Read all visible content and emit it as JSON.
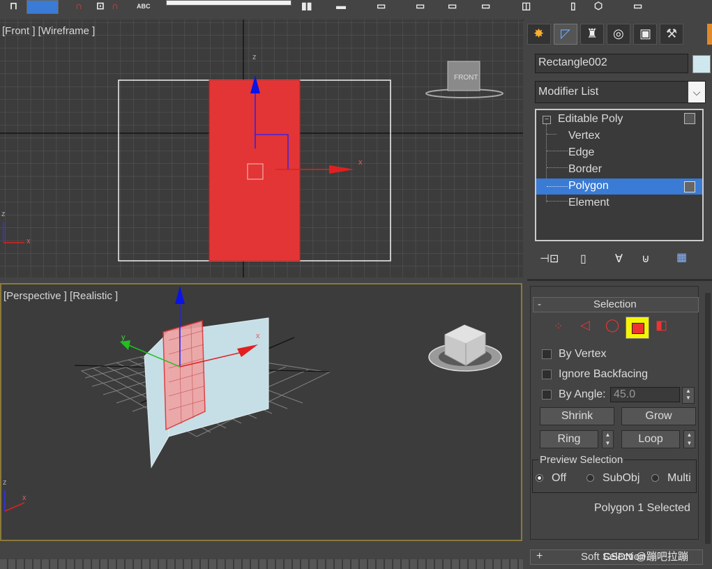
{
  "toolbar": {
    "abc_label": "ABC"
  },
  "viewports": {
    "front": {
      "label": "[Front ] [Wireframe ]",
      "viewcube": "FRONT",
      "axis_x": "x",
      "axis_z": "z",
      "corner_z": "z",
      "corner_x": "x"
    },
    "perspective": {
      "label": "[Perspective ] [Realistic ]",
      "axis_x": "x",
      "axis_y": "y",
      "corner_z": "z",
      "corner_x": "x"
    }
  },
  "command_panel": {
    "tabs": [
      "create-icon",
      "modify-icon",
      "hierarchy-icon",
      "motion-icon",
      "display-icon",
      "utilities-icon"
    ],
    "object_name": "Rectangle002",
    "object_color": "#cfe8ef",
    "modifier_list": "Modifier List",
    "stack": {
      "root": "Editable Poly",
      "items": [
        "Vertex",
        "Edge",
        "Border",
        "Polygon",
        "Element"
      ],
      "selected": "Polygon"
    },
    "selection": {
      "header_toggle": "-",
      "title": "Selection",
      "by_vertex": "By Vertex",
      "ignore_backfacing": "Ignore Backfacing",
      "by_angle": "By Angle:",
      "angle_value": "45.0",
      "shrink": "Shrink",
      "grow": "Grow",
      "ring": "Ring",
      "loop": "Loop",
      "preview_title": "Preview Selection",
      "preview_options": [
        "Off",
        "SubObj",
        "Multi"
      ],
      "preview_selected": "Off",
      "status": "Polygon 1 Selected"
    },
    "soft_selection": {
      "toggle": "+",
      "title": "Soft Selection"
    },
    "watermark": "CSDN @蹦吧拉蹦"
  },
  "colors": {
    "accent_selection": "#3a7bd5",
    "poly_red": "#e33535",
    "viewport_active_border": "#8a7a3a"
  }
}
